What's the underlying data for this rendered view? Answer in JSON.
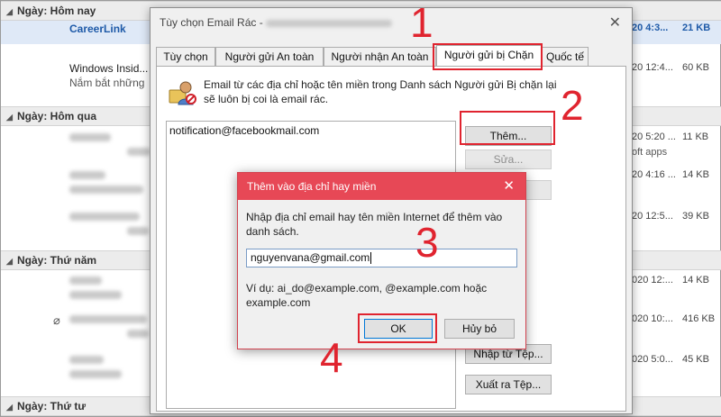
{
  "colors": {
    "accent_red": "#e0242f",
    "dialog_bar": "#e74856",
    "link_blue": "#1e5aa8"
  },
  "list": {
    "groups": {
      "today": "Ngày: Hôm nay",
      "yesterday": "Ngày: Hôm qua",
      "thursday": "Ngày: Thứ năm",
      "wednesday": "Ngày: Thứ tư"
    },
    "rows": [
      {
        "sender": "CareerLink",
        "date": "20 4:3...",
        "size": "21 KB"
      },
      {
        "sender": "Windows Insid...",
        "subject": "Nắm bắt những",
        "date": "20 12:4...",
        "size": "60 KB"
      },
      {
        "date": "20 5:20 ...",
        "size": "11 KB",
        "extra": "oft apps"
      },
      {
        "date": "20 4:16 ...",
        "size": "14 KB"
      },
      {
        "date": "20 12:5...",
        "size": "39 KB"
      },
      {
        "date": "020 12:...",
        "size": "14 KB"
      },
      {
        "date": "020 10:...",
        "size": "416 KB"
      },
      {
        "date": "020 5:0...",
        "size": "45 KB"
      }
    ]
  },
  "dialog": {
    "title": "Tùy chọn Email Rác - ",
    "tabs": [
      "Tùy chọn",
      "Người gửi An toàn",
      "Người nhận An toàn",
      "Người gửi bị Chặn",
      "Quốc tế"
    ],
    "description": "Email từ các địa chỉ hoặc tên miền trong Danh sách Người gửi Bị chặn lại sẽ luôn bị coi là email rác.",
    "list_item": "notification@facebookmail.com",
    "buttons": {
      "add": "Thêm...",
      "edit": "Sửa...",
      "import": "Nhập từ Tệp...",
      "export": "Xuất ra Tệp..."
    }
  },
  "add_dialog": {
    "title": "Thêm vào địa chỉ hay miền",
    "instruction": "Nhập địa chỉ email hay tên miền Internet để thêm vào danh sách.",
    "input_value": "nguyenvana@gmail.com",
    "example": "Ví dụ: ai_do@example.com, @example.com hoặc example.com",
    "ok": "OK",
    "cancel": "Hủy bỏ"
  },
  "annotations": [
    "1",
    "2",
    "3",
    "4"
  ]
}
